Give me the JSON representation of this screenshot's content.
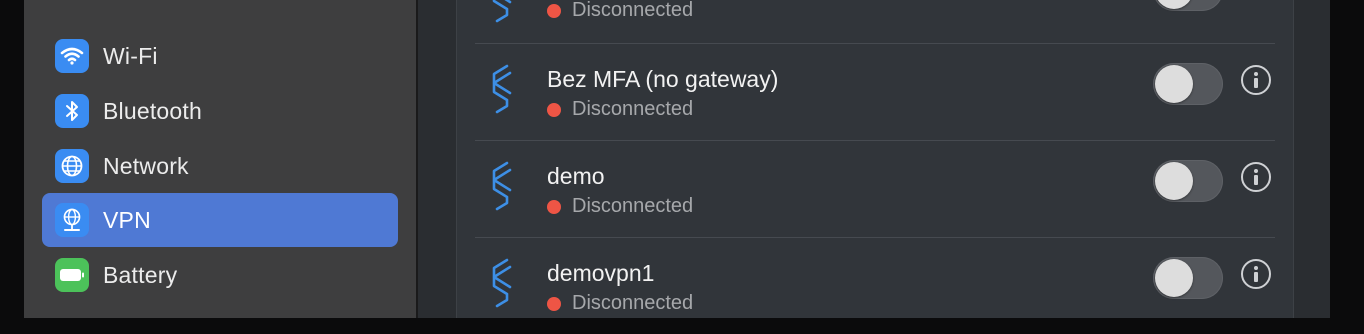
{
  "sidebar": {
    "items": [
      {
        "label": "Wi-Fi",
        "icon": "wifi-icon",
        "icon_color": "#3a8cf2",
        "selected": false
      },
      {
        "label": "Bluetooth",
        "icon": "bluetooth-icon",
        "icon_color": "#3a8cf2",
        "selected": false
      },
      {
        "label": "Network",
        "icon": "globe-icon",
        "icon_color": "#3a8cf2",
        "selected": false
      },
      {
        "label": "VPN",
        "icon": "vpn-globe-icon",
        "icon_color": "#3a8cf2",
        "selected": true
      },
      {
        "label": "Battery",
        "icon": "battery-icon",
        "icon_color": "#4cc25a",
        "selected": false
      }
    ],
    "selected_bg": "#4f79d4"
  },
  "vpn_list": [
    {
      "name": "",
      "status": "Disconnected",
      "enabled": false
    },
    {
      "name": "Bez MFA (no gateway)",
      "status": "Disconnected",
      "enabled": false
    },
    {
      "name": "demo",
      "status": "Disconnected",
      "enabled": false
    },
    {
      "name": "demovpn1",
      "status": "Disconnected",
      "enabled": false
    }
  ],
  "colors": {
    "status_disconnected": "#ee5545",
    "vpn_icon": "#3d8fe6"
  }
}
